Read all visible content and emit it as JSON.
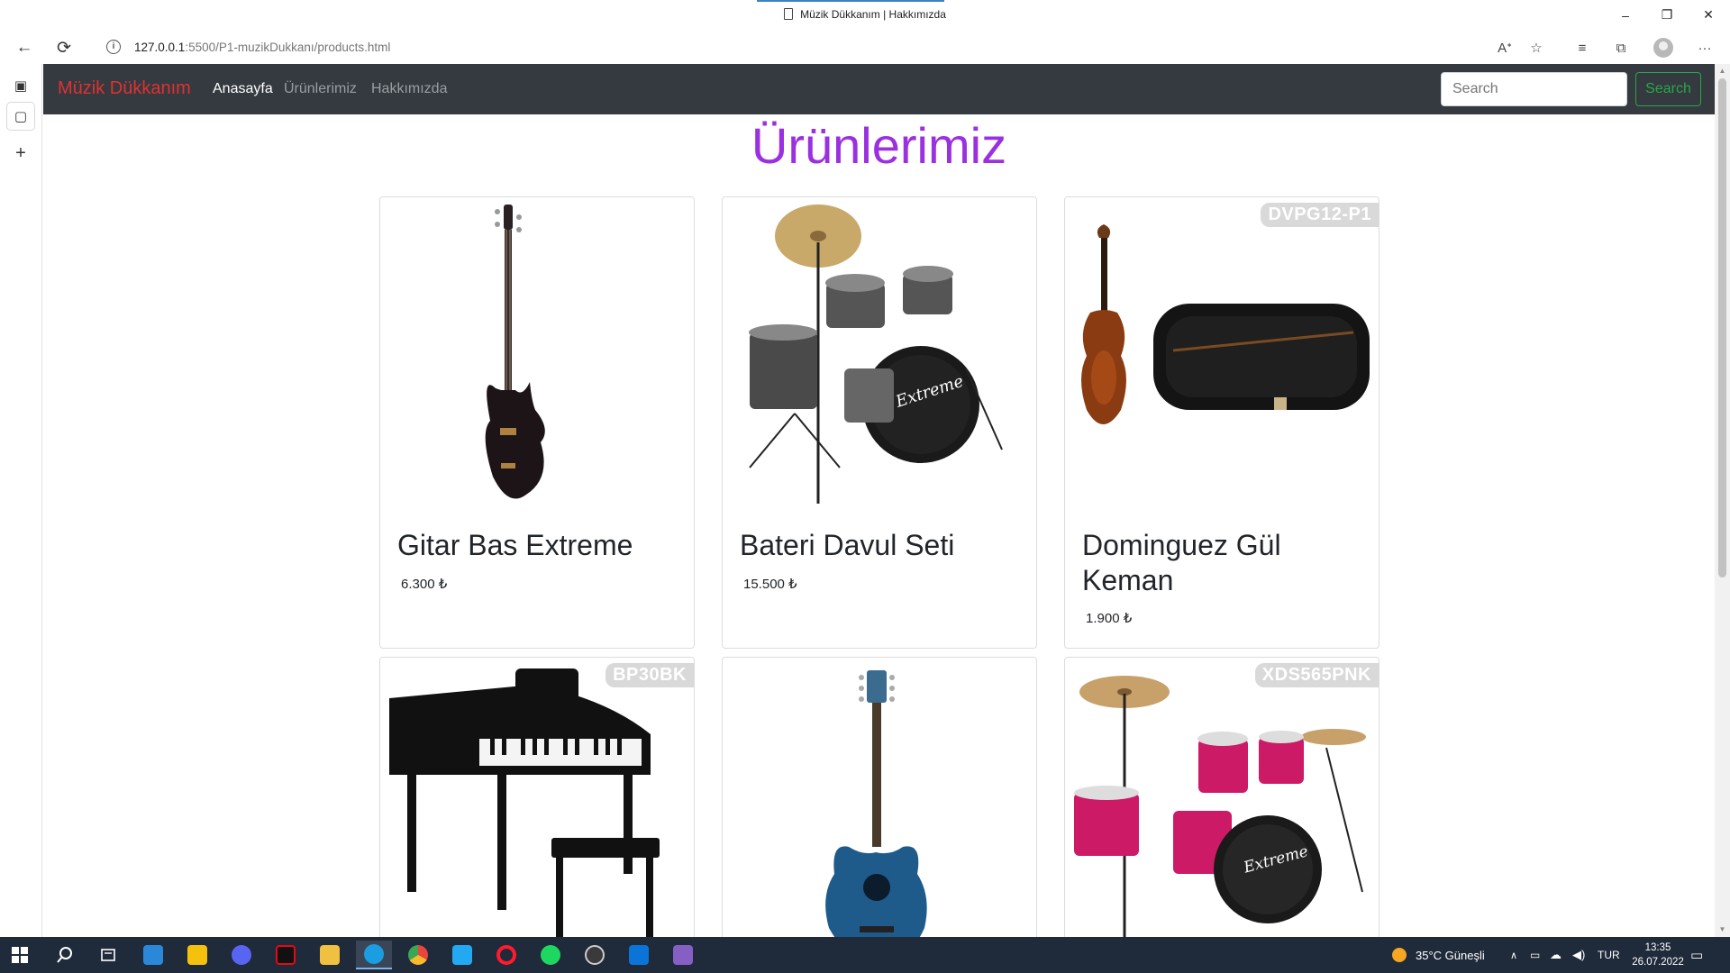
{
  "window": {
    "tab_title": "Müzik Dükkanım | Hakkımızda",
    "controls": {
      "minimize": "–",
      "restore": "❐",
      "close": "✕"
    }
  },
  "browser": {
    "url_host": "127.0.0.1",
    "url_rest": ":5500/P1-muzikDukkanı/products.html",
    "icons": [
      "back-arrow-icon",
      "refresh-icon",
      "info-icon",
      "read-aloud-icon",
      "add-favorite-icon",
      "favorites-icon",
      "collections-icon",
      "profile-icon",
      "more-icon"
    ],
    "glyphs": {
      "back": "←",
      "refresh": "⟳",
      "info": "i",
      "read_aloud": "Aᐩ",
      "add_favorite": "☆",
      "favorites": "≡",
      "collections": "⧉",
      "more": "···"
    }
  },
  "sidebar": {
    "glyphs": {
      "tabs": "▣",
      "page": "▢",
      "add": "+"
    }
  },
  "site": {
    "brand": "Müzik Dükkanım",
    "nav": [
      "Anasayfa",
      "Ürünlerimiz",
      "Hakkımızda"
    ],
    "search_placeholder": "Search",
    "search_button": "Search",
    "heading": "Ürünlerimiz"
  },
  "products": [
    {
      "name": "Gitar Bas Extreme",
      "price": "6.300 ₺",
      "sku": ""
    },
    {
      "name": "Bateri Davul Seti",
      "price": "15.500 ₺",
      "sku": ""
    },
    {
      "name": "Dominguez Gül Keman",
      "price": "1.900 ₺",
      "sku": "DVPG12-P1"
    },
    {
      "name": "",
      "price": "",
      "sku": "BP30BK"
    },
    {
      "name": "",
      "price": "",
      "sku": ""
    },
    {
      "name": "",
      "price": "",
      "sku": "XDS565PNK"
    }
  ],
  "taskbar": {
    "apps": [
      "windows-start-icon",
      "search-icon",
      "task-view-icon",
      "store-icon",
      "sticky-notes-icon",
      "discord-icon",
      "netflix-icon",
      "file-explorer-icon",
      "edge-icon",
      "chrome-icon",
      "vscode-icon",
      "opera-icon",
      "spotify-icon",
      "obs-icon",
      "mail-icon",
      "visual-studio-icon"
    ],
    "weather": "35°C  Güneşli",
    "language": "TUR",
    "time": "13:35",
    "date": "26.07.2022",
    "colors": {
      "store": "#2b88d8",
      "sticky": "#f4c20d",
      "discord": "#5865f2",
      "netflix": "#e50914",
      "explorer": "#f0c040",
      "edge": "#1b9de2",
      "chrome": "#e8453c",
      "vscode": "#23a9f2",
      "opera": "#ff1b2d",
      "spotify": "#1ed760",
      "obs": "#3a3a3a",
      "mail": "#0a74d8",
      "vs": "#865fc5"
    }
  },
  "colors": {
    "brand_red": "#e03131",
    "heading_purple": "#9b30e0",
    "nav_bg": "#343a40",
    "search_green": "#28a745"
  }
}
